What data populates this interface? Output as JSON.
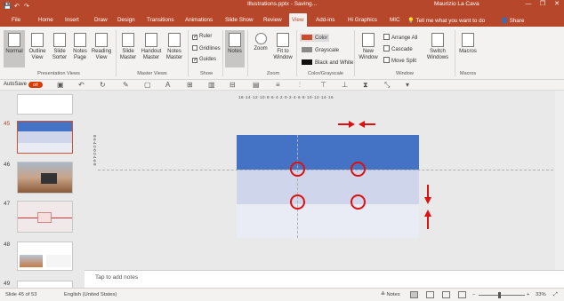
{
  "title_bar": {
    "title": "Illustrations.pptx  -  Saving...",
    "user": "Maurizio La Cava",
    "minimize": "—",
    "restore": "❐",
    "close": "✕"
  },
  "qat": {
    "save": "💾",
    "undo": "↶",
    "redo": "↷"
  },
  "tabs": [
    {
      "label": "File"
    },
    {
      "label": "Home"
    },
    {
      "label": "Insert"
    },
    {
      "label": "Draw"
    },
    {
      "label": "Design"
    },
    {
      "label": "Transitions"
    },
    {
      "label": "Animations"
    },
    {
      "label": "Slide Show"
    },
    {
      "label": "Review"
    },
    {
      "label": "View"
    },
    {
      "label": "Add-ins"
    },
    {
      "label": "Hi Graphics"
    },
    {
      "label": "MIC"
    }
  ],
  "active_tab": "View",
  "tell_me": "💡 Tell me what you want to do",
  "share": "👤 Share",
  "ribbon": {
    "presentation_views": {
      "label": "Presentation Views",
      "buttons": [
        "Normal",
        "Outline View",
        "Slide Sorter",
        "Notes Page",
        "Reading View"
      ]
    },
    "master_views": {
      "label": "Master Views",
      "buttons": [
        "Slide Master",
        "Handout Master",
        "Notes Master"
      ]
    },
    "show": {
      "label": "Show",
      "checks": [
        {
          "label": "Ruler",
          "checked": true
        },
        {
          "label": "Gridlines",
          "checked": false
        },
        {
          "label": "Guides",
          "checked": true
        }
      ]
    },
    "notes": {
      "label": "Notes"
    },
    "zoom": {
      "label": "Zoom",
      "buttons": [
        "Zoom",
        "Fit to Window"
      ]
    },
    "color": {
      "label": "Color/Grayscale",
      "items": [
        {
          "label": "Color",
          "swatch": "#d04a2c"
        },
        {
          "label": "Grayscale",
          "swatch": "#8a8a8a"
        },
        {
          "label": "Black and White",
          "swatch": "#111111"
        }
      ]
    },
    "window": {
      "label": "Window",
      "new_window": "New Window",
      "items": [
        "Arrange All",
        "Cascade",
        "Move Split"
      ],
      "switch": "Switch Windows"
    },
    "macros": {
      "label": "Macros",
      "button": "Macros"
    }
  },
  "toolbar2": {
    "autosave": "AutoSave",
    "toggle": "Off"
  },
  "slides": [
    {
      "num": "45",
      "current": true
    },
    {
      "num": "46",
      "current": false
    },
    {
      "num": "47",
      "current": false
    },
    {
      "num": "48",
      "current": false
    },
    {
      "num": "49",
      "current": false
    }
  ],
  "ruler_h": "16·14·12·10·8·6·4·2·0·2·4·6·8·10·12·14·16",
  "ruler_v": "8·6·4·2·0·2·4·6·8",
  "colors": {
    "brand": "#b7472a",
    "band_top": "#4472c4",
    "band_mid": "#cfd5ea",
    "band_bot": "#e9ebf5",
    "annotation_red": "#d11111"
  },
  "notes_placeholder": "Tap to add notes",
  "status": {
    "slide": "Slide 45 of 53",
    "language": "English (United States)",
    "notes": "≙ Notes",
    "zoom": "33%",
    "fit": "⤢"
  }
}
